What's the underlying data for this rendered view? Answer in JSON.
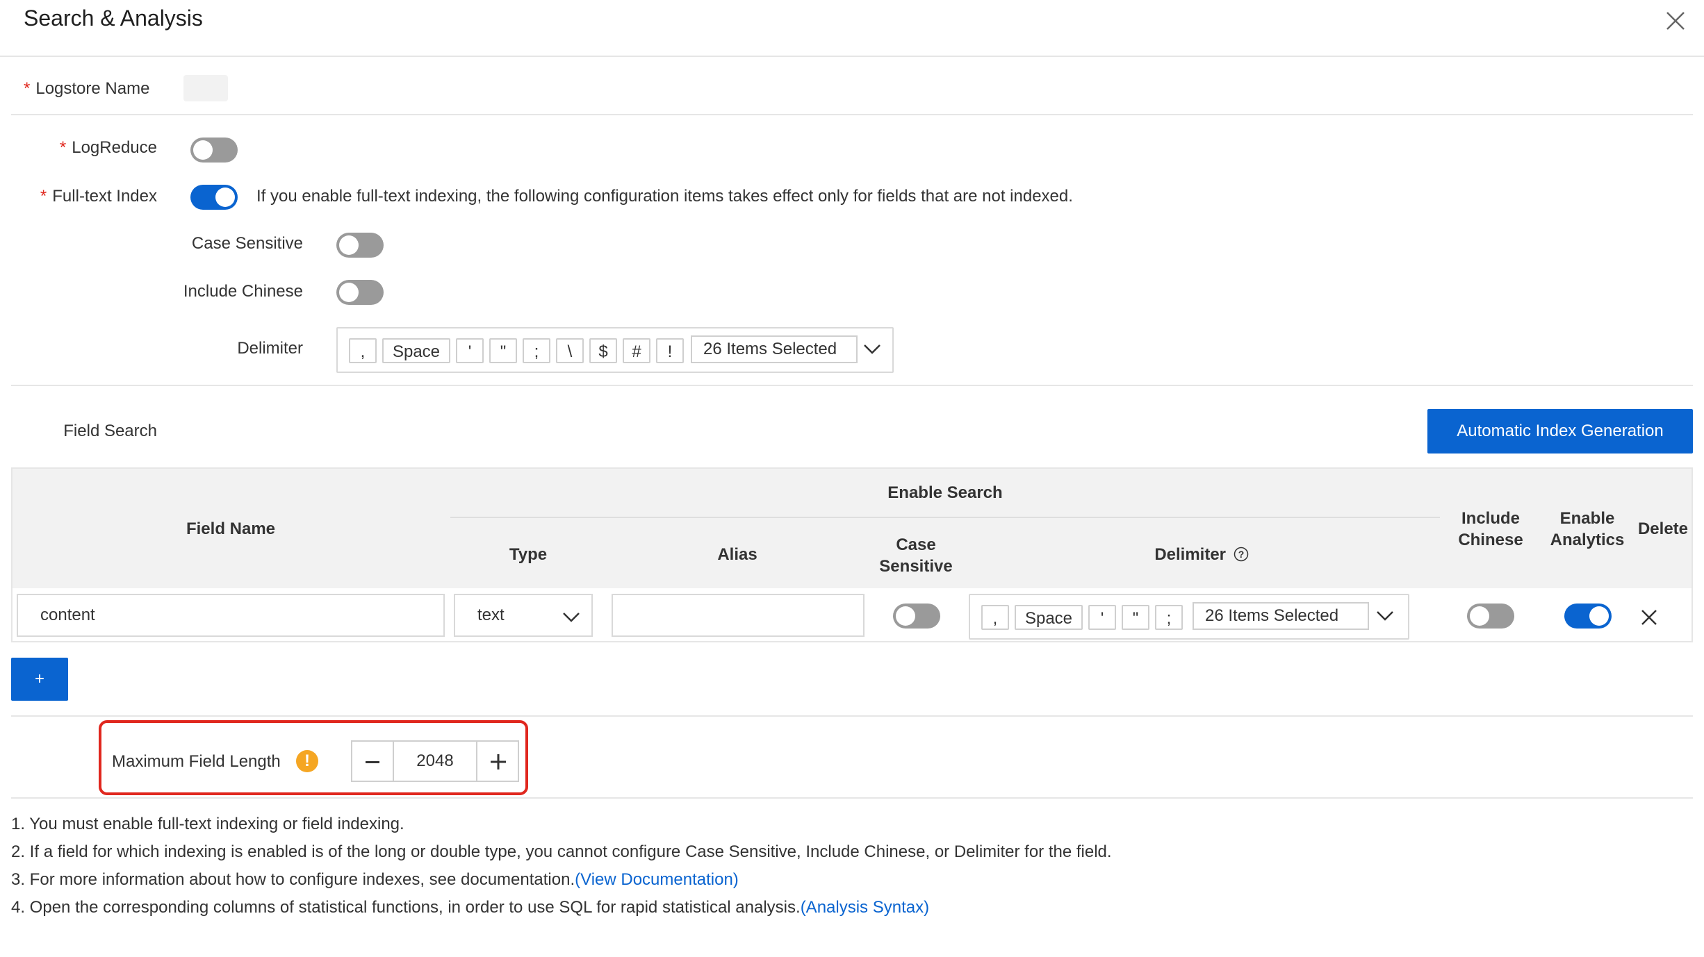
{
  "header": {
    "title": "Search & Analysis"
  },
  "form": {
    "logstore_label": "Logstore Name",
    "logreduce_label": "LogReduce",
    "fulltext_label": "Full-text Index",
    "fulltext_hint": "If you enable full-text indexing, the following configuration items takes effect only for fields that are not indexed.",
    "case_sensitive_label": "Case Sensitive",
    "include_chinese_label": "Include Chinese",
    "delimiter_label": "Delimiter",
    "delimiter_tags": [
      ",",
      "Space",
      "'",
      "\"",
      ";",
      "\\",
      "$",
      "#",
      "!"
    ],
    "delimiter_summary": "26 Items Selected",
    "toggles": {
      "logreduce": false,
      "fulltext": true,
      "case_sensitive": false,
      "include_chinese": false
    }
  },
  "field_search": {
    "label": "Field Search",
    "auto_button": "Automatic Index Generation"
  },
  "table": {
    "headers": {
      "field_name": "Field Name",
      "enable_search": "Enable Search",
      "type": "Type",
      "alias": "Alias",
      "case_sensitive_1": "Case",
      "case_sensitive_2": "Sensitive",
      "delimiter": "Delimiter",
      "include_chinese_1": "Include",
      "include_chinese_2": "Chinese",
      "enable_analytics_1": "Enable",
      "enable_analytics_2": "Analytics",
      "delete": "Delete"
    },
    "rows": [
      {
        "field_name": "content",
        "type": "text",
        "alias": "",
        "case_sensitive": false,
        "delimiter_tags": [
          ",",
          "Space",
          "'",
          "\"",
          ";"
        ],
        "delimiter_summary": "26 Items Selected",
        "include_chinese": false,
        "enable_analytics": true
      }
    ],
    "add_button": "+"
  },
  "max_field_length": {
    "label": "Maximum Field Length",
    "value": "2048",
    "minus": "−",
    "plus": "+"
  },
  "notes": {
    "n1": "1. You must enable full-text indexing or field indexing.",
    "n2": "2. If a field for which indexing is enabled is of the long or double type, you cannot configure Case Sensitive, Include Chinese, or Delimiter for the field.",
    "n3_text": "3. For more information about how to configure indexes, see documentation.",
    "n3_link": "(View Documentation)",
    "n4_text": "4. Open the corresponding columns of statistical functions, in order to use SQL for rapid statistical analysis.",
    "n4_link": "(Analysis Syntax)"
  },
  "colors": {
    "primary": "#0a64d0",
    "required": "#e0271e",
    "highlight": "#e0271e",
    "warning": "#f5a623"
  }
}
